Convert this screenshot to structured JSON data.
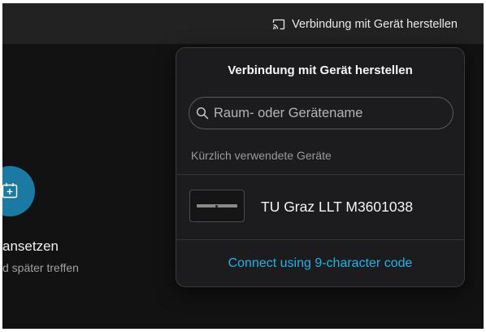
{
  "header": {
    "connect_button_label": "Verbindung mit Gerät herstellen",
    "connect_icon": "cast-icon"
  },
  "background": {
    "fab_icon": "calendar-add-icon",
    "fab_color": "#1a7aa3",
    "title_partial": "ansetzen",
    "subtitle_partial": "d später treffen"
  },
  "popover": {
    "title": "Verbindung mit Gerät herstellen",
    "search": {
      "placeholder": "Raum- oder Gerätename",
      "value": "",
      "icon": "search-icon"
    },
    "recent_label": "Kürzlich verwendete Geräte",
    "devices": [
      {
        "name": "TU Graz LLT M3601038",
        "icon": "device-bar-icon"
      }
    ],
    "code_link": "Connect using 9-character code",
    "link_color": "#1fb4e8"
  }
}
